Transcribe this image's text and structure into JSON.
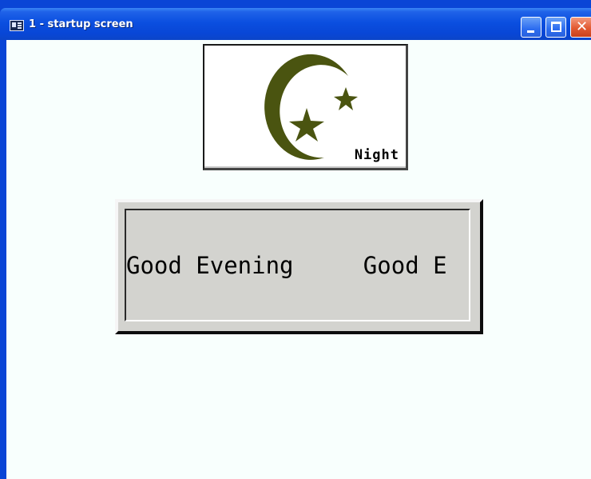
{
  "window": {
    "title": "1 - startup screen",
    "controls": [
      "minimize",
      "maximize",
      "close"
    ]
  },
  "night_button": {
    "icon": "moon-stars-icon",
    "label": "Night",
    "icon_color": "#4a5410"
  },
  "greeting": {
    "text": "Good Evening     Good E"
  }
}
